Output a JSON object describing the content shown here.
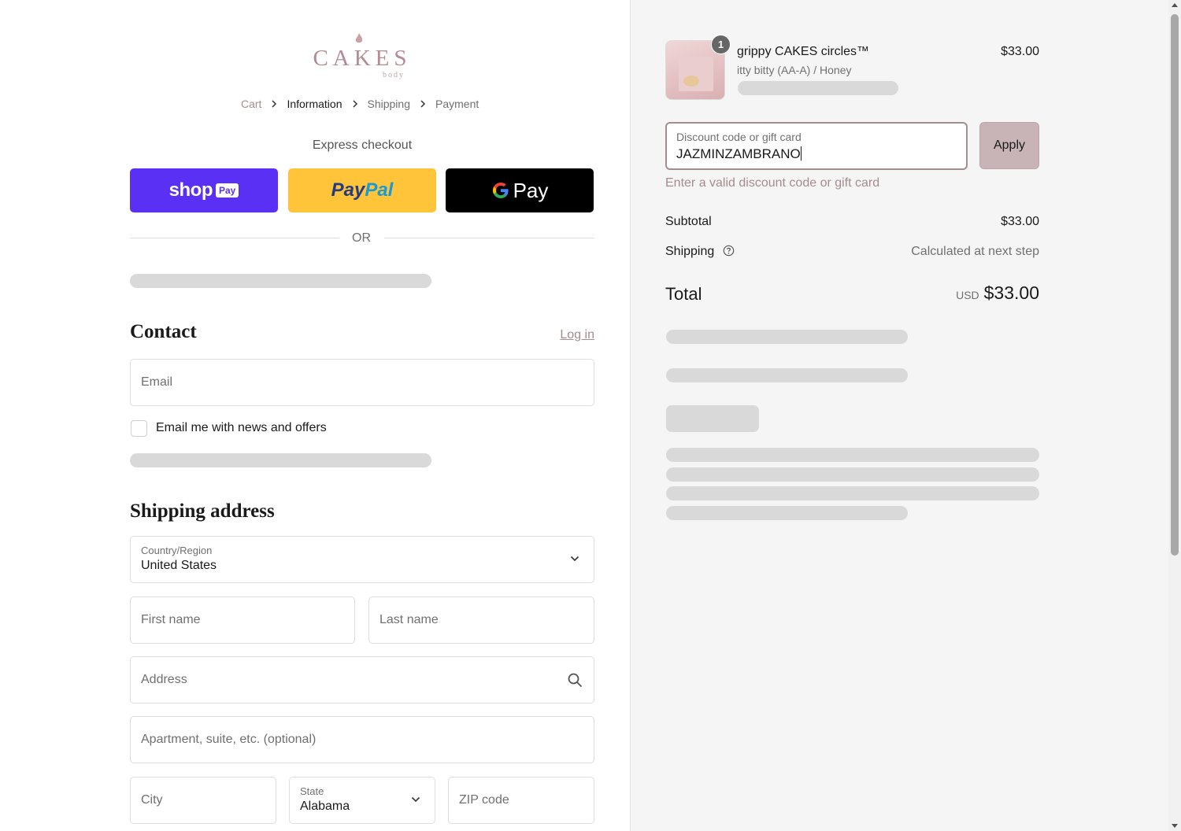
{
  "brand": {
    "logo_text": "CAKES",
    "logo_sub": "body",
    "accent_color": "#a48c8f"
  },
  "breadcrumb": [
    {
      "label": "Cart"
    },
    {
      "label": "Information"
    },
    {
      "label": "Shipping"
    },
    {
      "label": "Payment"
    }
  ],
  "express": {
    "title": "Express checkout",
    "shop_pay": {
      "shop": "shop",
      "pay": "Pay",
      "color": "#5a31f4"
    },
    "paypal": {
      "part1": "Pay",
      "part2": "Pal",
      "color": "#ffc439"
    },
    "gpay": {
      "g": "G",
      "pay": "Pay",
      "color": "#000000"
    },
    "or_text": "OR"
  },
  "contact": {
    "title": "Contact",
    "login": "Log in",
    "email_placeholder": "Email",
    "news_label": "Email me with news and offers"
  },
  "shipping": {
    "title": "Shipping address",
    "country_label": "Country/Region",
    "country_value": "United States",
    "first_name": "First name",
    "last_name": "Last name",
    "address": "Address",
    "apartment": "Apartment, suite, etc. (optional)",
    "city": "City",
    "state_label": "State",
    "state_value": "Alabama",
    "zip": "ZIP code"
  },
  "order": {
    "quantity": "1",
    "product_name": "grippy CAKES circles™",
    "product_variant": "itty bitty (AA-A) / Honey",
    "product_price": "$33.00",
    "discount_label": "Discount code or gift card",
    "discount_value": "JAZMINZAMBRANO",
    "apply_label": "Apply",
    "discount_error": "Enter a valid discount code or gift card",
    "subtotal_label": "Subtotal",
    "subtotal_value": "$33.00",
    "shipping_label": "Shipping",
    "shipping_value": "Calculated at next step",
    "total_label": "Total",
    "total_currency": "USD",
    "total_value": "$33.00"
  }
}
